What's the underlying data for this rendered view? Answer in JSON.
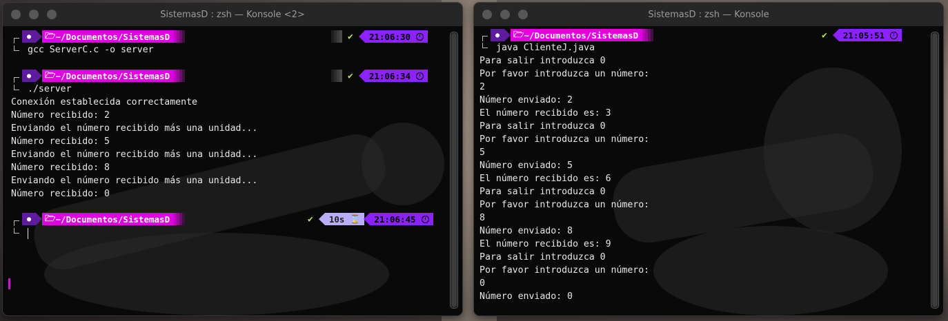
{
  "colors": {
    "prompt_path_bg": "#e100e1",
    "prompt_os_bg": "#5e1b9e",
    "time_bg": "#8b22ff",
    "duration_bg": "#b8aef8",
    "check": "#b5e853",
    "text": "#e8e8e8"
  },
  "icons": {
    "os": "linux-distro-icon",
    "folder": "folder-open-icon",
    "check": "check-icon",
    "clock": "clock-icon",
    "hourglass": "hourglass-icon"
  },
  "left": {
    "title": "SistemasD : zsh — Konsole <2>",
    "prompts": [
      {
        "path_prefix": "~/Documentos/",
        "path_dir": "SistemasD",
        "command": "gcc ServerC.c -o server",
        "time": "21:06:30",
        "duration": ""
      },
      {
        "path_prefix": "~/Documentos/",
        "path_dir": "SistemasD",
        "command": "./server",
        "time": "21:06:34",
        "duration": ""
      },
      {
        "path_prefix": "~/Documentos/",
        "path_dir": "SistemasD",
        "command": "",
        "time": "21:06:45",
        "duration": "10s"
      }
    ],
    "output": [
      "Conexión establecida correctamente",
      "Número recibido: 2",
      "Enviando el número recibido más una unidad...",
      "Número recibido: 5",
      "Enviando el número recibido más una unidad...",
      "Número recibido: 8",
      "Enviando el número recibido más una unidad...",
      "Número recibido: 0"
    ]
  },
  "right": {
    "title": "SistemasD : zsh — Konsole",
    "prompt": {
      "path_prefix": "~/Documentos/",
      "path_dir": "SistemasD",
      "command": "java ClienteJ.java",
      "time": "21:05:51"
    },
    "output": [
      "Para salir introduzca 0",
      "Por favor introduzca un número:",
      "2",
      "Número enviado: 2",
      "El número recibido es: 3",
      "Para salir introduzca 0",
      "Por favor introduzca un número:",
      "5",
      "Número enviado: 5",
      "El número recibido es: 6",
      "Para salir introduzca 0",
      "Por favor introduzca un número:",
      "8",
      "Número enviado: 8",
      "El número recibido es: 9",
      "Para salir introduzca 0",
      "Por favor introduzca un número:",
      "0",
      "Número enviado: 0"
    ]
  }
}
